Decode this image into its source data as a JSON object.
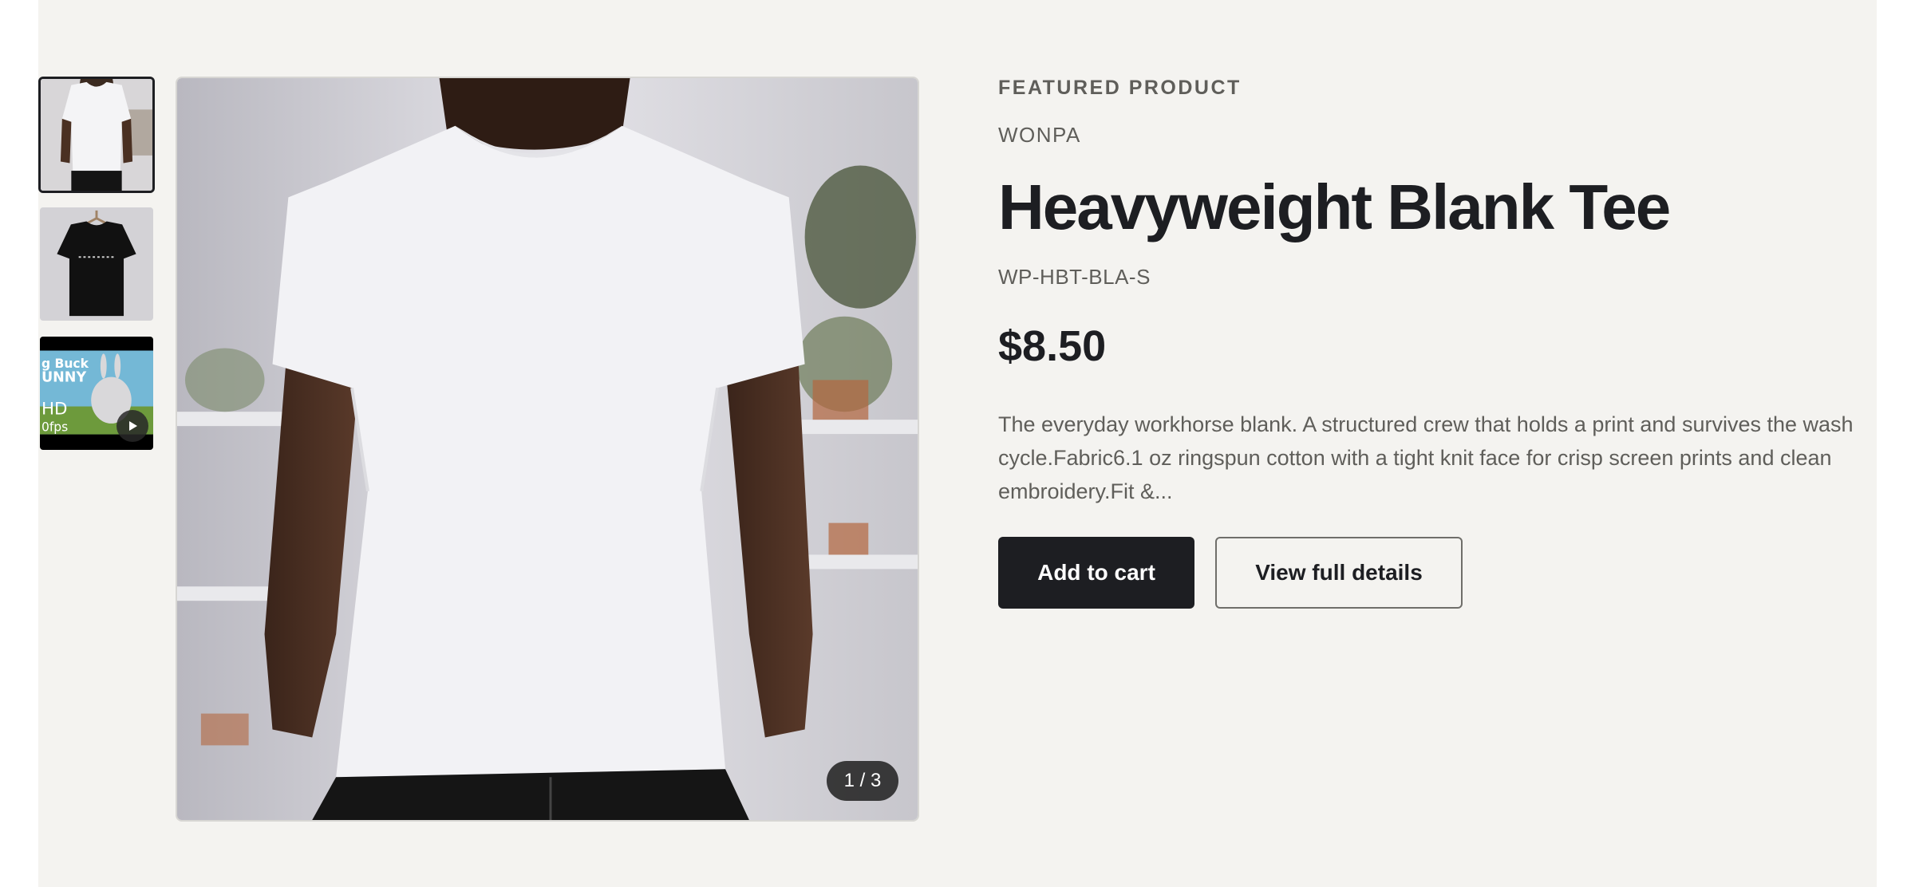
{
  "product": {
    "eyebrow": "FEATURED PRODUCT",
    "vendor": "WONPA",
    "title": "Heavyweight Blank Tee",
    "sku": "WP-HBT-BLA-S",
    "price": "$8.50",
    "description": "The everyday workhorse blank. A structured crew that holds a print and survives the wash cycle.Fabric6.1 oz ringspun cotton with a tight knit face for crisp screen prints and clean embroidery.Fit &..."
  },
  "gallery": {
    "counter": "1 / 3",
    "thumbnails": [
      {
        "kind": "image",
        "subject": "white-tee-model",
        "active": true
      },
      {
        "kind": "image",
        "subject": "black-tee-hanger",
        "active": false
      },
      {
        "kind": "video",
        "subject": "big-buck-bunny",
        "active": false,
        "overlay_text": [
          "g Buck",
          "UNNY",
          "HD",
          "0fps"
        ]
      }
    ]
  },
  "actions": {
    "add_to_cart": "Add to cart",
    "view_details": "View full details"
  },
  "colors": {
    "panel_bg": "#f4f3f0",
    "text_dark": "#1d1e22",
    "text_muted": "#5f5e5a",
    "button_bg": "#1d1e22"
  },
  "icons": {
    "video_badge": "play-icon"
  }
}
